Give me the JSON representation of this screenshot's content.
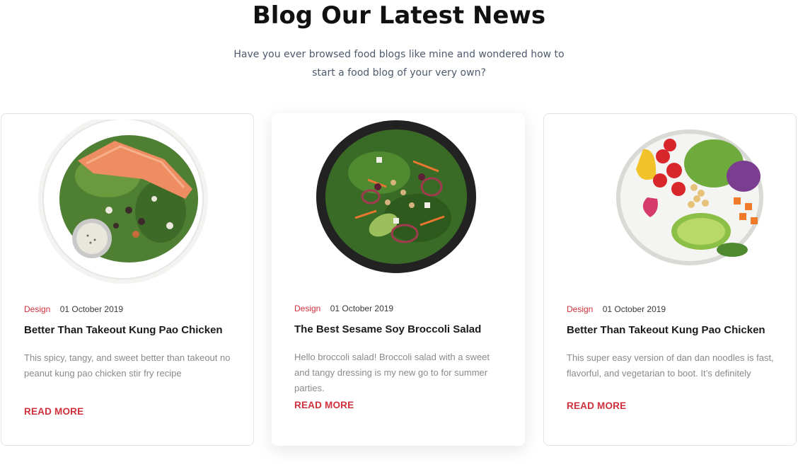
{
  "header": {
    "title": "Blog Our Latest News",
    "subtitle": "Have you ever browsed food blogs like mine and wondered how to start a food blog of your very own?"
  },
  "cards": [
    {
      "image_icon": "salmon-salad-bowl-image",
      "category": "Design",
      "date": "01 October 2019",
      "title": "Better Than Takeout Kung Pao Chicken",
      "excerpt": "This spicy, tangy, and sweet better than takeout no peanut kung pao chicken stir fry recipe",
      "link": "READ MORE"
    },
    {
      "image_icon": "broccoli-salad-plate-image",
      "category": "Design",
      "date": "01 October 2019",
      "title": "The Best Sesame Soy Broccoli Salad",
      "excerpt": "Hello broccoli salad! Broccoli salad with a sweet and tangy dressing is my new go to for summer parties.",
      "link": "READ MORE"
    },
    {
      "image_icon": "vegetable-bowl-image",
      "category": "Design",
      "date": "01 October 2019",
      "title": "Better Than Takeout Kung Pao Chicken",
      "excerpt": "This super easy version of dan dan noodles is fast, flavorful, and vegetarian to boot. It’s definitely",
      "link": "READ MORE"
    }
  ],
  "colors": {
    "accent": "#d0303c",
    "title": "#111111",
    "body_text": "#8a8a8a",
    "card_border": "#e3e3e3"
  }
}
